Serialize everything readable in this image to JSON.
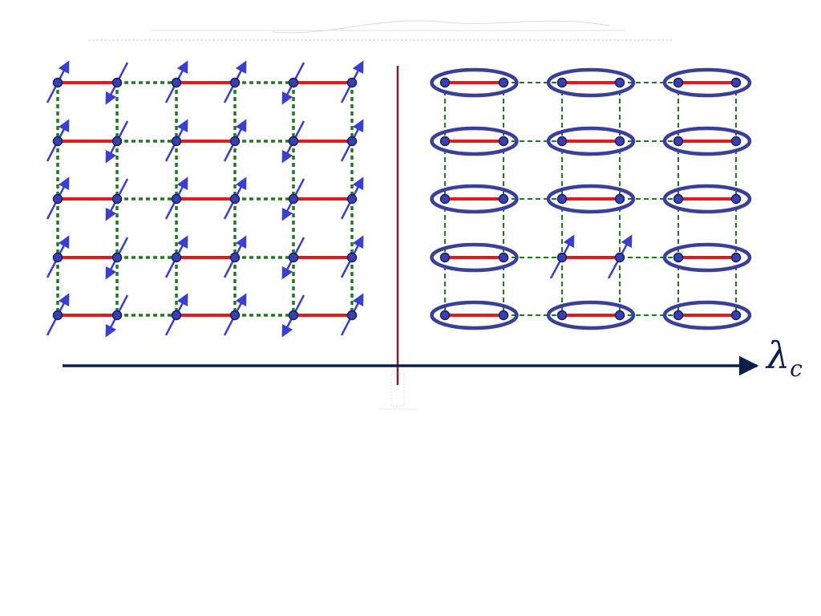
{
  "colors": {
    "singlet_bond": "#e41a1c",
    "weak_bond": "#1f7a1f",
    "site_fill": "#3a3fb0",
    "site_stroke": "#1a1f5e",
    "spin_arrow": "#3a3fcf",
    "dimer_ellipse": "#3a3f9a",
    "axis": "#0b1f4f",
    "divider": "#7a1f2f"
  },
  "axis": {
    "symbol": "λ",
    "subscript": "c",
    "arrowhead": "right"
  },
  "left_phase": {
    "rows": 5,
    "sites_per_row": 6,
    "spin_tilt": [
      "up",
      "down",
      "up",
      "up",
      "down",
      "up"
    ]
  },
  "right_phase": {
    "rows": 5,
    "dimers_per_row": 3,
    "broken_dimer": {
      "row": 4,
      "dimer": 2
    }
  }
}
